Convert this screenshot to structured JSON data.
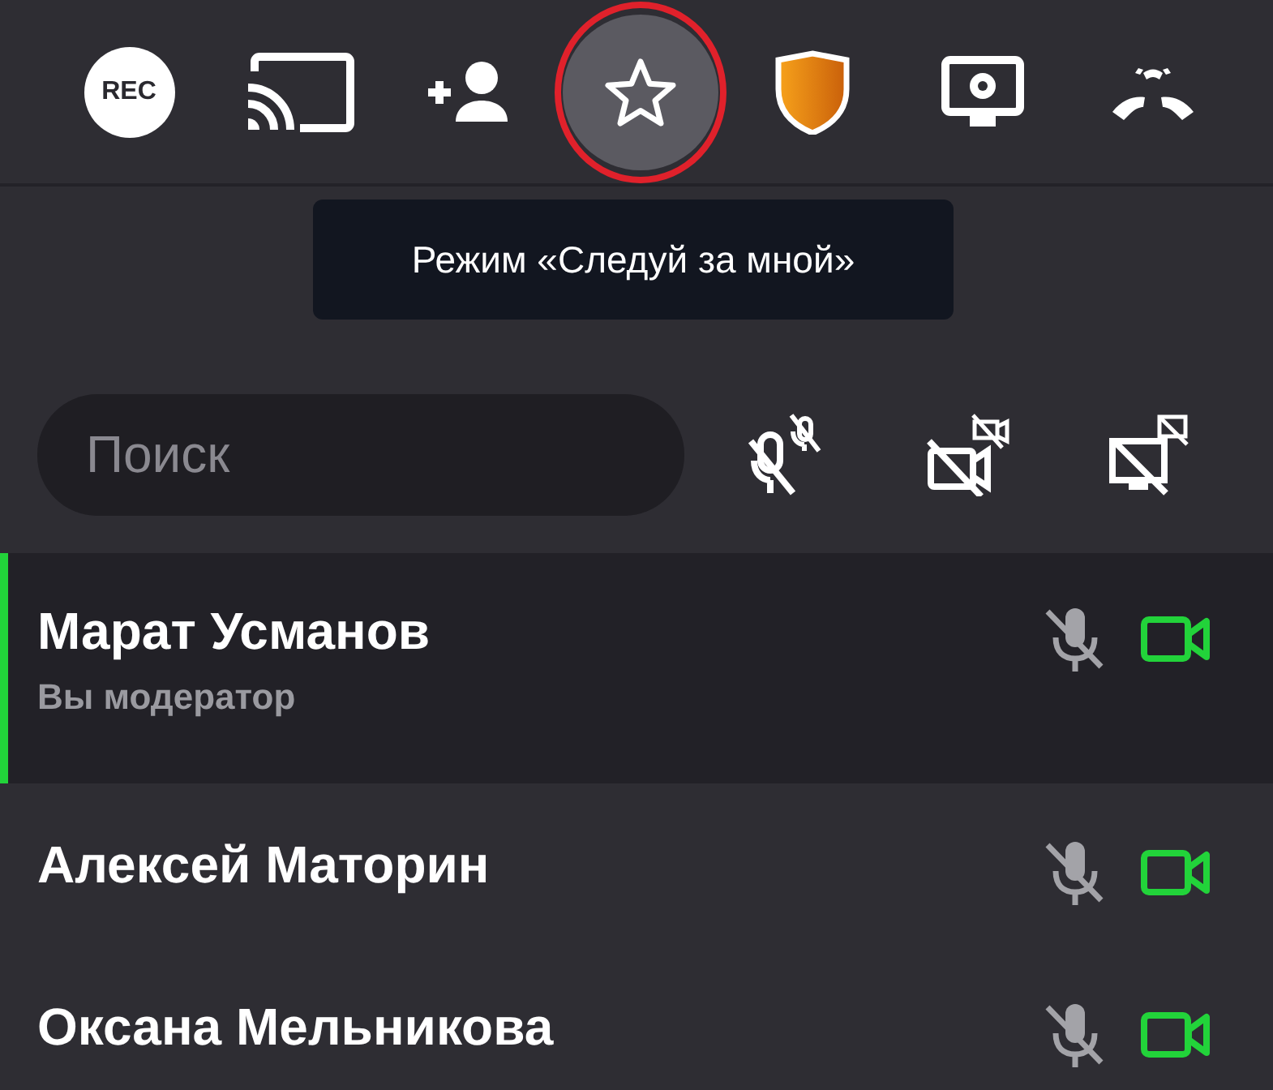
{
  "toolbar": [
    {
      "kind": "rec",
      "label": "REC",
      "selected": false
    },
    {
      "kind": "cast",
      "selected": false
    },
    {
      "kind": "add-user",
      "selected": false
    },
    {
      "kind": "follow",
      "selected": true
    },
    {
      "kind": "shield",
      "selected": false
    },
    {
      "kind": "screen-settings",
      "selected": false
    },
    {
      "kind": "hangup",
      "selected": false
    }
  ],
  "tooltip": {
    "text": "Режим «Следуй за мной»"
  },
  "search": {
    "placeholder": "Поиск"
  },
  "bulk_actions": [
    {
      "kind": "mute-all-mics"
    },
    {
      "kind": "disable-all-cameras"
    },
    {
      "kind": "disable-all-screens"
    }
  ],
  "participants": [
    {
      "name": "Марат Усманов",
      "role": "Вы модератор",
      "selected": true,
      "mic_muted": true,
      "camera_on": true
    },
    {
      "name": "Алексей Маторин",
      "selected": false,
      "mic_muted": true,
      "camera_on": true
    },
    {
      "name": "Оксана Мельникова",
      "selected": false,
      "mic_muted": true,
      "camera_on": true
    }
  ]
}
